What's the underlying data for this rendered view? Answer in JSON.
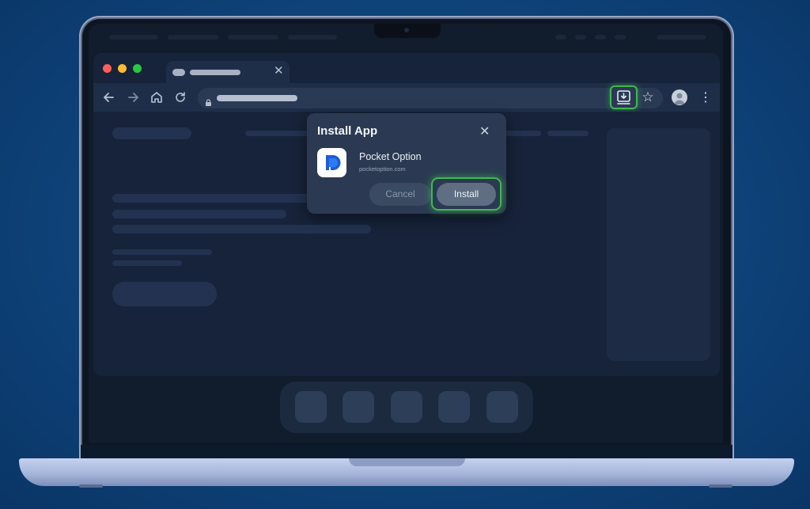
{
  "dialog": {
    "title": "Install App",
    "close_icon": "close-icon",
    "app_name": "Pocket Option",
    "app_url": "pocketoption.com",
    "cancel_label": "Cancel",
    "install_label": "Install"
  },
  "toolbar": {
    "icons": [
      "back-arrow-icon",
      "forward-arrow-icon",
      "home-icon",
      "reload-icon",
      "lock-icon",
      "install-app-icon",
      "bookmark-star-icon",
      "profile-avatar",
      "more-menu-icon"
    ]
  },
  "window": {
    "traffic_lights": [
      "#ff5f57",
      "#febc2e",
      "#28c840"
    ],
    "highlight_color": "#3fb94f"
  },
  "dock": {
    "item_count": 5
  }
}
